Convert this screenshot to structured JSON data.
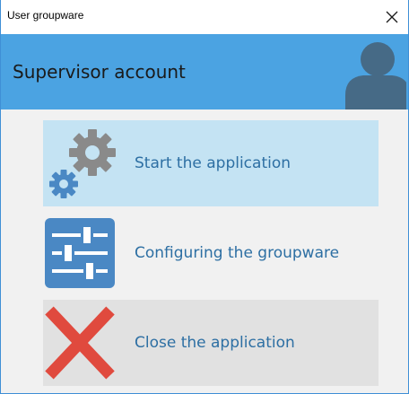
{
  "window": {
    "title": "User groupware",
    "close_glyph": "✕"
  },
  "header": {
    "title": "Supervisor account",
    "background": "#4ba3e2",
    "avatar_icon": "user-silhouette-icon"
  },
  "menu": {
    "items": [
      {
        "label": "Start the application",
        "icon": "gears-icon",
        "background": "#c4e3f3"
      },
      {
        "label": "Configuring the groupware",
        "icon": "sliders-icon",
        "background": "#f1f1f1"
      },
      {
        "label": "Close the application",
        "icon": "red-x-icon",
        "background": "#e1e1e1"
      }
    ]
  },
  "colors": {
    "accent_blue": "#4a88c4",
    "label_text": "#2d6fa3",
    "gear_gray": "#8a8a8a",
    "close_red": "#e04a3e"
  }
}
